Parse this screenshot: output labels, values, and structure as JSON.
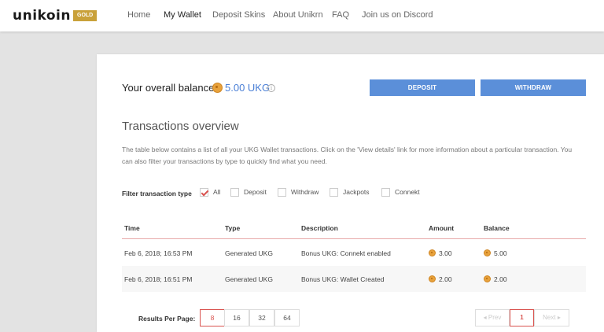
{
  "brand": {
    "name": "unikoin",
    "badge": "GOLD"
  },
  "nav": {
    "items": [
      "Home",
      "My Wallet",
      "Deposit Skins",
      "About Unikrn",
      "FAQ",
      "Join us on Discord"
    ],
    "active": "My Wallet"
  },
  "balance": {
    "label": "Your overall balance",
    "value": "5.00 UKG",
    "info_icon": "i"
  },
  "actions": {
    "deposit": "DEPOSIT",
    "withdraw": "WITHDRAW"
  },
  "transactions": {
    "title": "Transactions overview",
    "description": "The table below contains a list of all your UKG Wallet transactions. Click on the 'View details' link for more information about a particular transaction. You can also filter your transactions by type to quickly find what you need.",
    "filter_label": "Filter transaction type",
    "filters": [
      {
        "label": "All",
        "checked": true
      },
      {
        "label": "Deposit",
        "checked": false
      },
      {
        "label": "Withdraw",
        "checked": false
      },
      {
        "label": "Jackpots",
        "checked": false
      },
      {
        "label": "Connekt",
        "checked": false
      }
    ],
    "columns": [
      "Time",
      "Type",
      "Description",
      "Amount",
      "Balance"
    ],
    "rows": [
      {
        "time": "Feb 6, 2018; 16:53 PM",
        "type": "Generated UKG",
        "description": "Bonus UKG: Connekt enabled",
        "amount": "3.00",
        "balance": "5.00"
      },
      {
        "time": "Feb 6, 2018; 16:51 PM",
        "type": "Generated UKG",
        "description": "Bonus UKG: Wallet Created",
        "amount": "2.00",
        "balance": "2.00"
      }
    ]
  },
  "pagination": {
    "results_label": "Results Per Page:",
    "per_page_options": [
      "8",
      "16",
      "32",
      "64"
    ],
    "per_page_selected": "8",
    "prev": "◂ Prev",
    "next": "Next ▸",
    "current_page": "1"
  },
  "colors": {
    "accent_blue": "#5b8fd9",
    "accent_red": "#d9534f",
    "gold": "#c9a13a",
    "coin": "#e8a23c"
  }
}
